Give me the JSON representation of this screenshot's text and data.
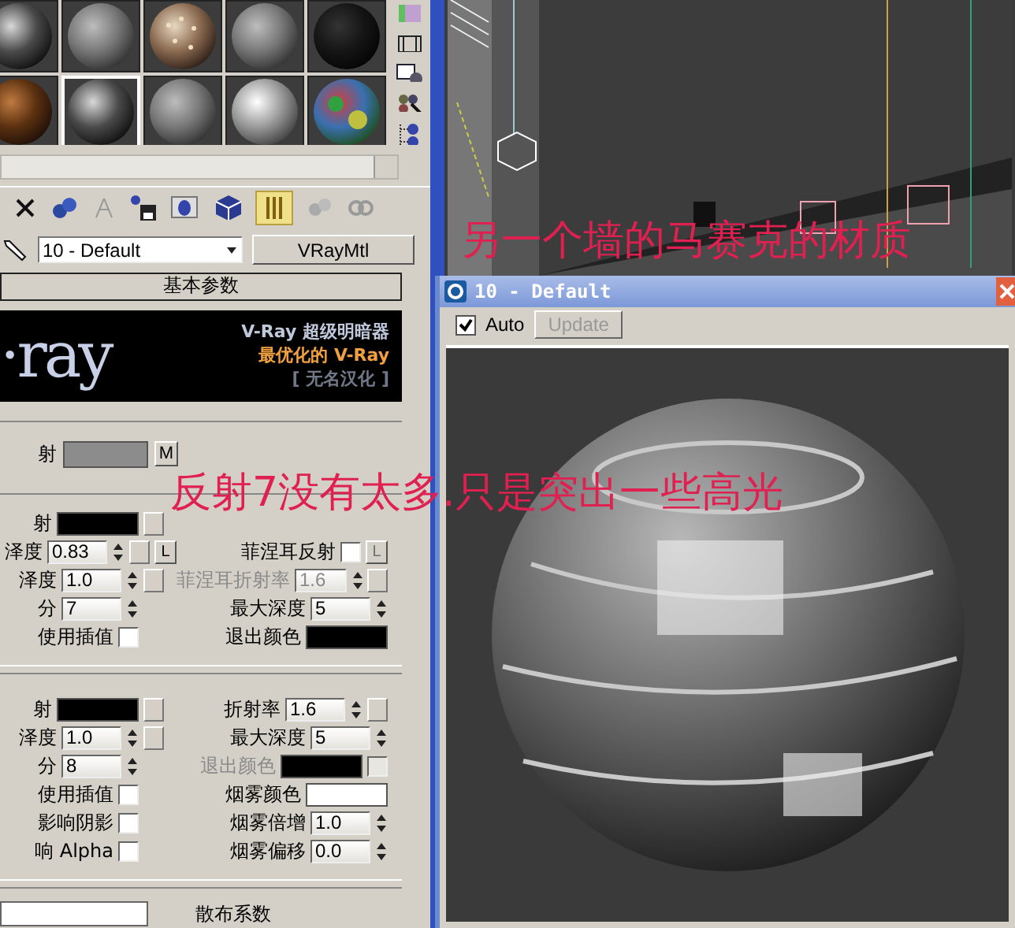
{
  "sample_slots": [
    {
      "kind": "glass",
      "selected": false
    },
    {
      "kind": "matte",
      "selected": false
    },
    {
      "kind": "dots",
      "selected": false
    },
    {
      "kind": "matte",
      "selected": false
    },
    {
      "kind": "dark",
      "selected": false
    },
    {
      "kind": "wood",
      "selected": false
    },
    {
      "kind": "glass",
      "selected": true
    },
    {
      "kind": "matte",
      "selected": false
    },
    {
      "kind": "gloss",
      "selected": false
    },
    {
      "kind": "mosaic",
      "selected": false
    }
  ],
  "material": {
    "name": "10 - Default",
    "type_button": "VRayMtl"
  },
  "rollout": {
    "title": "基本参数"
  },
  "banner": {
    "logo": "·ray",
    "line_1": "V-Ray 超级明暗器",
    "line_2": "最优化的 V-Ray",
    "line_3": "[ 无名汉化 ]"
  },
  "diffuse": {
    "label": "射",
    "color": "#8c8c8c",
    "map_button": "M"
  },
  "reflection": [
    {
      "left": {
        "kind": "color",
        "label": "射",
        "color": "#000000",
        "map": true
      }
    },
    {
      "left": {
        "kind": "spinner",
        "label": "泽度",
        "value": "0.83",
        "map": true,
        "lock": {
          "label": "L",
          "disabled": false
        }
      },
      "right": {
        "kind": "check",
        "label": "菲涅耳反射",
        "checked": false,
        "lock": {
          "label": "L",
          "disabled": true
        }
      }
    },
    {
      "left": {
        "kind": "spinner",
        "label": "泽度",
        "value": "1.0",
        "map": true
      },
      "right": {
        "kind": "spinner",
        "label": "菲涅耳折射率",
        "value": "1.6",
        "disabled": true,
        "map": true
      }
    },
    {
      "left": {
        "kind": "spinner",
        "label": "分",
        "value": "7"
      },
      "right": {
        "kind": "spinner",
        "label": "最大深度",
        "value": "5"
      }
    },
    {
      "left": {
        "kind": "check",
        "label": "使用插值",
        "checked": false
      },
      "right": {
        "kind": "color",
        "label": "退出颜色",
        "color": "#000000"
      }
    }
  ],
  "refraction": [
    {
      "left": {
        "kind": "color",
        "label": "射",
        "color": "#000000",
        "map": true
      },
      "right": {
        "kind": "spinner",
        "label": "折射率",
        "value": "1.6",
        "map": true
      }
    },
    {
      "left": {
        "kind": "spinner",
        "label": "泽度",
        "value": "1.0",
        "map": true
      },
      "right": {
        "kind": "spinner",
        "label": "最大深度",
        "value": "5"
      }
    },
    {
      "left": {
        "kind": "spinner",
        "label": "分",
        "value": "8"
      },
      "right": {
        "kind": "color",
        "label": "退出颜色",
        "color": "#000000",
        "disabled": true,
        "trail_check": {
          "checked": false
        }
      }
    },
    {
      "left": {
        "kind": "check",
        "label": "使用插值",
        "checked": false
      },
      "right": {
        "kind": "color",
        "label": "烟雾颜色",
        "color": "#ffffff"
      }
    },
    {
      "left": {
        "kind": "check",
        "label": "影响阴影",
        "checked": false
      },
      "right": {
        "kind": "spinner",
        "label": "烟雾倍增",
        "value": "1.0"
      }
    },
    {
      "left": {
        "kind": "check",
        "label": "响 Alpha",
        "checked": false
      },
      "right": {
        "kind": "spinner",
        "label": "烟雾偏移",
        "value": "0.0"
      }
    }
  ],
  "next_group": {
    "label": "散布系数"
  },
  "preview_window": {
    "title": "10 - Default",
    "auto": {
      "label": "Auto",
      "checked": true
    },
    "update_button": {
      "label": "Update",
      "disabled": true
    }
  },
  "annotations": [
    "另一个墙的马赛克的材质",
    "反射7没有太多.只是突出一些高光"
  ]
}
